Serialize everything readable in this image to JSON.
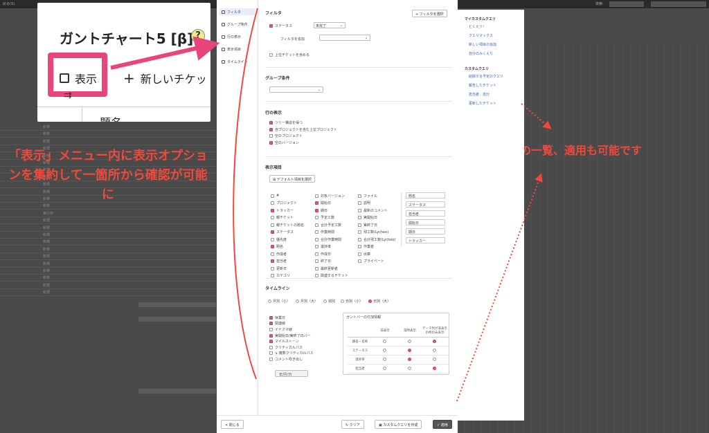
{
  "background": {
    "title_hint": "戻る(S)",
    "search_label": "検索:",
    "rows": [
      "新規",
      "新規",
      "新規",
      "新規",
      "新規",
      "新規",
      "新規",
      "新規",
      "新規",
      "新規",
      "新規",
      "新規",
      "実行中",
      "新規",
      "新規",
      "新規",
      "新規",
      "新規",
      "新規",
      "新規",
      "新規",
      "新規",
      "新規",
      "新規"
    ]
  },
  "zoom": {
    "title": "ガントチャート5 [β]",
    "help": "?",
    "menu_display": "表示",
    "menu_new_ticket": "新しいチケット",
    "col_subject": "題名",
    "highlight_color": "#e8457a"
  },
  "annotations": {
    "left": "「表示」メニュー内に表示オプションを集約して一箇所から確認が可能に",
    "right": "クエリの一覧、適用も可能です",
    "color": "#f0483c"
  },
  "dialog": {
    "nav": [
      {
        "label": "フィルタ",
        "icon": "filter-icon",
        "active": true
      },
      {
        "label": "グループ条件",
        "icon": "group-icon",
        "active": false
      },
      {
        "label": "行の表示",
        "icon": "rows-icon",
        "active": false
      },
      {
        "label": "表示項目",
        "icon": "columns-icon",
        "active": false
      },
      {
        "label": "タイムライン",
        "icon": "timeline-icon",
        "active": false
      }
    ],
    "filter": {
      "title": "フィルタ",
      "add_filter_button": "+ フィルタを選択",
      "status_label": "ステータス",
      "status_operator": "未完了",
      "add_filter_label": "フィルタを追加",
      "include_parent": "上位チケットを含める"
    },
    "group": {
      "title": "グループ条件"
    },
    "rows": {
      "title": "行の表示",
      "options": [
        {
          "label": "ツリー構造を保つ",
          "checked": true
        },
        {
          "label": "自プロジェクトを含む上位プロジェクト",
          "checked": true
        },
        {
          "label": "空のプロジェクト",
          "checked": false
        },
        {
          "label": "空のバージョン",
          "checked": true
        }
      ]
    },
    "columns": {
      "title": "表示項目",
      "default_button": "デフォルト項目を選択",
      "col1": [
        {
          "label": "#",
          "checked": false
        },
        {
          "label": "プロジェクト",
          "checked": false
        },
        {
          "label": "トラッカー",
          "checked": true
        },
        {
          "label": "親チケット",
          "checked": false
        },
        {
          "label": "親チケットの題名",
          "checked": false
        },
        {
          "label": "ステータス",
          "checked": true
        },
        {
          "label": "優先度",
          "checked": false
        },
        {
          "label": "題名",
          "checked": true
        },
        {
          "label": "作成者",
          "checked": false
        },
        {
          "label": "担当者",
          "checked": true
        },
        {
          "label": "更新日",
          "checked": false
        },
        {
          "label": "カテゴリ",
          "checked": false
        }
      ],
      "col2": [
        {
          "label": "対象バージョン",
          "checked": false
        },
        {
          "label": "開始日",
          "checked": true
        },
        {
          "label": "期日",
          "checked": true
        },
        {
          "label": "予定工数",
          "checked": false
        },
        {
          "label": "合計予定工数",
          "checked": false
        },
        {
          "label": "作業時間",
          "checked": false
        },
        {
          "label": "合計作業時間",
          "checked": false
        },
        {
          "label": "進捗率",
          "checked": false
        },
        {
          "label": "作成日",
          "checked": false
        },
        {
          "label": "終了日",
          "checked": false
        },
        {
          "label": "最終更新者",
          "checked": false
        },
        {
          "label": "関連するチケット",
          "checked": false
        }
      ],
      "col3": [
        {
          "label": "ファイル",
          "checked": false
        },
        {
          "label": "説明",
          "checked": false
        },
        {
          "label": "最新のコメント",
          "checked": false
        },
        {
          "label": "実開始日",
          "checked": false
        },
        {
          "label": "実終了日",
          "checked": false
        },
        {
          "label": "残工数(Lychee)",
          "checked": false
        },
        {
          "label": "合計残工数(Lychee)",
          "checked": false
        },
        {
          "label": "作業者",
          "checked": false
        },
        {
          "label": "出庫",
          "checked": false
        },
        {
          "label": "プライベート",
          "checked": false
        }
      ],
      "selected": [
        "題名",
        "ステータス",
        "担当者",
        "開始日",
        "期日",
        "トラッカー"
      ]
    },
    "timeline": {
      "title": "タイムライン",
      "scales": [
        {
          "label": "月別（小）",
          "checked": false
        },
        {
          "label": "月別（大）",
          "checked": false
        },
        {
          "label": "週別",
          "checked": false
        },
        {
          "label": "日別（小）",
          "checked": false
        },
        {
          "label": "日別（大）",
          "checked": true
        }
      ],
      "options": [
        {
          "label": "休業日",
          "checked": true
        },
        {
          "label": "関連線",
          "checked": true
        },
        {
          "label": "イナズマ線",
          "checked": false
        },
        {
          "label": "実開始日/実終了日バー",
          "checked": true
        },
        {
          "label": "マイルストーン",
          "checked": true
        },
        {
          "label": "クリティカルパス",
          "checked": false
        },
        {
          "label": "↳ 複数クリティカルパス",
          "checked": false
        },
        {
          "label": "コメント吹き出し",
          "checked": false
        }
      ],
      "date_placeholder": "年/月/日",
      "attr_box": {
        "title": "ガントバーの付加情報",
        "headers": [
          "非表示",
          "常時表示",
          "データ列が非表示の時のみ表示"
        ],
        "rows": [
          {
            "name": "題名・名称",
            "selected": 2
          },
          {
            "name": "ステータス",
            "selected": 1
          },
          {
            "name": "進捗率",
            "selected": 1
          },
          {
            "name": "担当者",
            "selected": 2
          }
        ]
      }
    },
    "footer": {
      "close": "✕ 閉じる",
      "clear": "クリア",
      "save_query": "カスタムクエリを作成",
      "apply": "✓ 適用"
    }
  },
  "query_panel": {
    "my_title": "マイカスタムクエリ",
    "my_items": [
      "とくえう！",
      "クエリマックス",
      "新しい項目の追加",
      "自分のみくえり"
    ],
    "custom_title": "カスタムクエリ",
    "custom_items": [
      "削除する予定のクエリ",
      "報告したチケット",
      "担当者：自分",
      "更新したチケット"
    ]
  }
}
